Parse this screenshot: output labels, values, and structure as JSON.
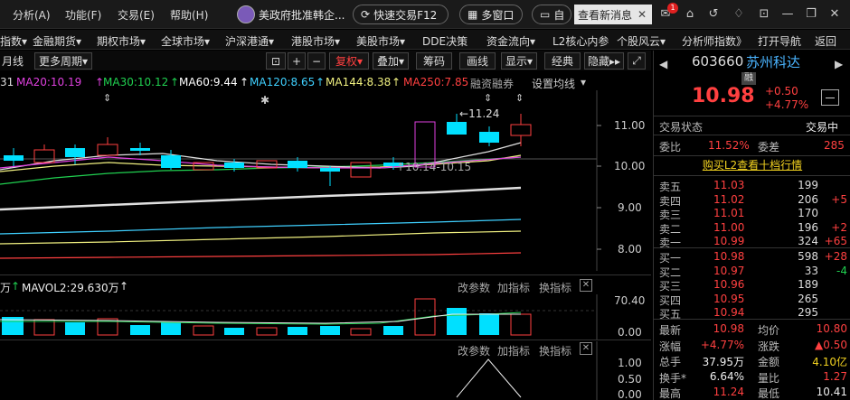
{
  "titlebar": {
    "menus": [
      "分析(A)",
      "功能(F)",
      "交易(E)",
      "帮助(H)"
    ],
    "news": "美政府批准韩企...",
    "quick_trade": "快速交易F12",
    "multi_window": "多窗口",
    "self_select": "自",
    "view_new_msg": "查看新消息",
    "mail_count": "1"
  },
  "nav": {
    "items": [
      "指数▾",
      "金融期货▾",
      "期权市场▾",
      "全球市场▾",
      "沪深港通▾",
      "港股市场▾",
      "美股市场▾",
      "DDE决策",
      "资金流向▾",
      "L2核心内参",
      "个股风云▾",
      "分析师指数》",
      "打开导航",
      "返回"
    ]
  },
  "toolbar": {
    "period": "月线",
    "more_period": "更多周期",
    "fuquan": "复权",
    "overlay": "叠加",
    "chips": "筹码",
    "draw_line": "画线",
    "display": "显示",
    "classic": "经典",
    "hide": "隐藏"
  },
  "ma_legend": {
    "ma_prefix": "31",
    "ma20": "MA20:10.19",
    "ma30": "MA30:10.12",
    "ma60": "MA60:9.44",
    "ma120": "MA120:8.65",
    "ma144": "MA144:8.38",
    "ma250": "MA250:7.85",
    "margin": "融资融券",
    "settings": "设置均线"
  },
  "chart": {
    "y_labels": [
      "11.00",
      "10.00",
      "9.00",
      "8.00"
    ],
    "high_label": "11.24",
    "range_label": "10.14-10.15",
    "colors": {
      "up": "#ff4040",
      "down": "#00e0ff",
      "ma20": "#e040e0",
      "ma30": "#20d050",
      "ma60": "#ffffff",
      "ma120": "#3fd0ff",
      "ma144": "#f0f080",
      "ma250": "#ff4040"
    }
  },
  "volume": {
    "prefix": "万",
    "mavol2": "MAVOL2:29.630万",
    "edit_params": "改参数",
    "add_indicator": "加指标",
    "switch_indicator": "换指标",
    "y_labels": [
      "70.40",
      "0.00"
    ]
  },
  "sub_panel": {
    "edit_params": "改参数",
    "add_indicator": "加指标",
    "switch_indicator": "换指标",
    "y_labels": [
      "1.00",
      "0.50",
      "0.00"
    ]
  },
  "quote": {
    "code": "603660",
    "name": "苏州科达",
    "rong": "融",
    "price": "10.98",
    "change": "+0.50",
    "change_pct": "+4.77%",
    "status_label": "交易状态",
    "status_value": "交易中",
    "weibi_label": "委比",
    "weibi_value": "11.52%",
    "weicha_label": "委差",
    "weicha_value": "285",
    "l2_link": "购买L2查看十档行情",
    "sells": [
      {
        "label": "卖五",
        "price": "11.03",
        "vol": "199",
        "delta": ""
      },
      {
        "label": "卖四",
        "price": "11.02",
        "vol": "206",
        "delta": "+5"
      },
      {
        "label": "卖三",
        "price": "11.01",
        "vol": "170",
        "delta": ""
      },
      {
        "label": "卖二",
        "price": "11.00",
        "vol": "196",
        "delta": "+2"
      },
      {
        "label": "卖一",
        "price": "10.99",
        "vol": "324",
        "delta": "+65"
      }
    ],
    "buys": [
      {
        "label": "买一",
        "price": "10.98",
        "vol": "598",
        "delta": "+28"
      },
      {
        "label": "买二",
        "price": "10.97",
        "vol": "33",
        "delta": "-4"
      },
      {
        "label": "买三",
        "price": "10.96",
        "vol": "189",
        "delta": ""
      },
      {
        "label": "买四",
        "price": "10.95",
        "vol": "265",
        "delta": ""
      },
      {
        "label": "买五",
        "price": "10.94",
        "vol": "295",
        "delta": ""
      }
    ],
    "stats": [
      {
        "k1": "最新",
        "v1": "10.98",
        "k2": "均价",
        "v2": "10.80"
      },
      {
        "k1": "涨幅",
        "v1": "+4.77%",
        "k2": "涨跌",
        "v2": "▲0.50"
      },
      {
        "k1": "总手",
        "v1": "37.95万",
        "k2": "金额",
        "v2": "4.10亿"
      },
      {
        "k1": "换手*",
        "v1": "6.64%",
        "k2": "量比",
        "v2": "1.27"
      },
      {
        "k1": "最高",
        "v1": "11.24",
        "k2": "最低",
        "v2": "10.41"
      }
    ]
  }
}
